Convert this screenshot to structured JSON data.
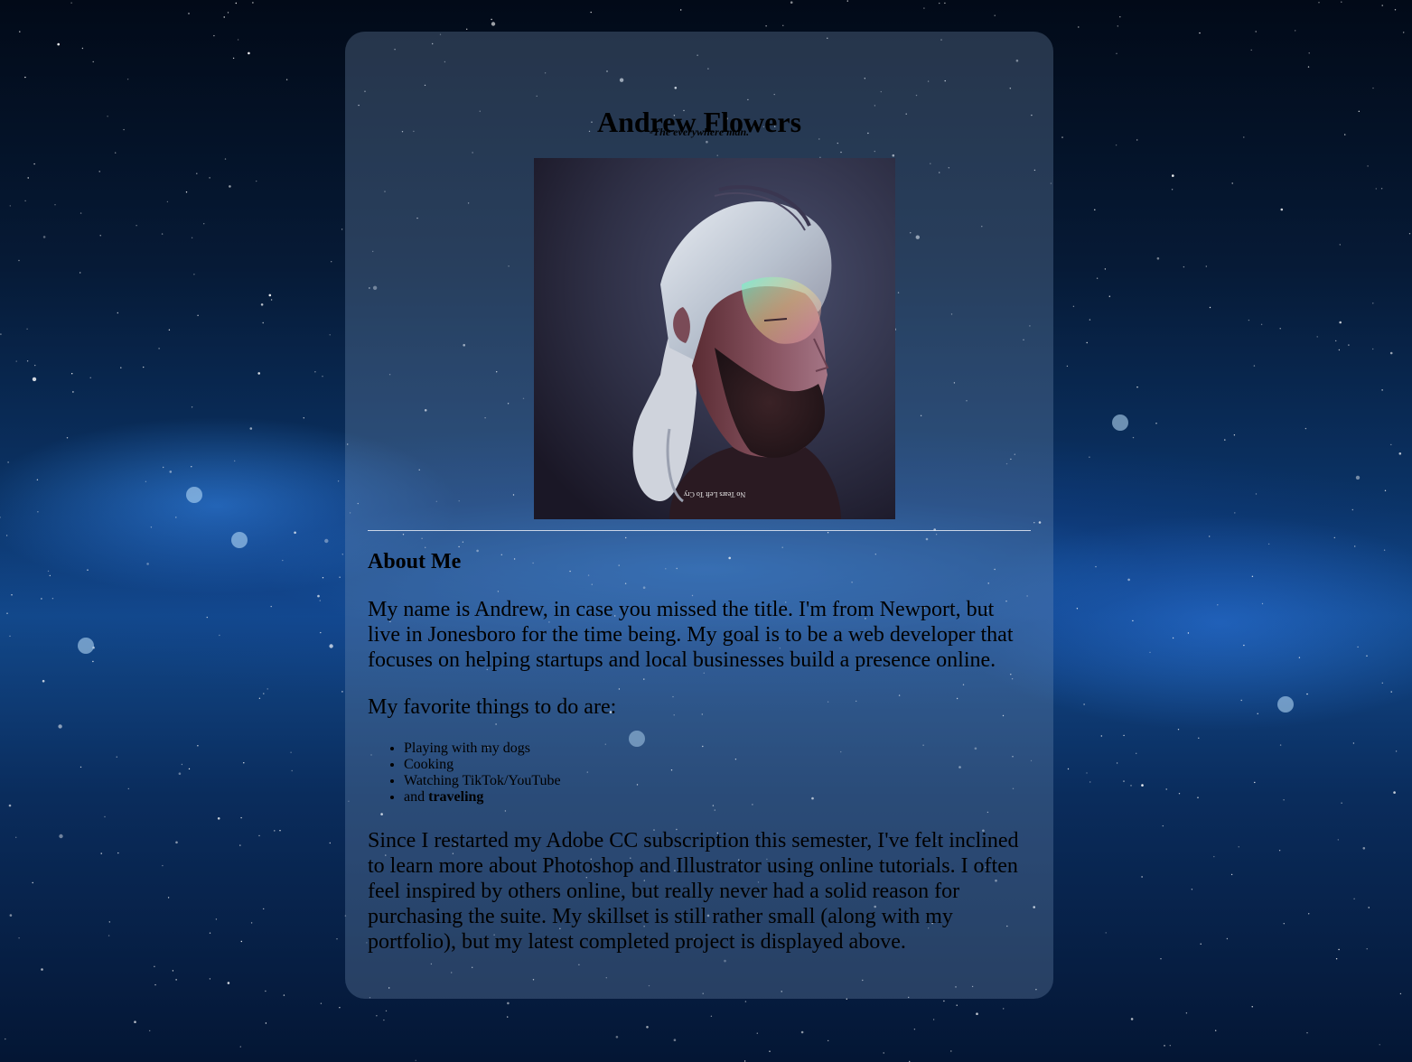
{
  "profile": {
    "name": "Andrew Flowers",
    "tagline": "-The everywhere man.",
    "portrait_caption": "No Tears Left To Cry"
  },
  "about": {
    "heading": "About Me",
    "intro": "My name is Andrew, in case you missed the title. I'm from Newport, but live in Jonesboro for the time being. My goal is to be a web developer that focuses on helping startups and local businesses build a presence online.",
    "favorites_intro": "My favorite things to do are:",
    "favorites": [
      "Playing with my dogs",
      "Cooking",
      "Watching TikTok/YouTube"
    ],
    "favorite_last_prefix": "and",
    "favorite_last_emphasis": "traveling",
    "closing": "Since I restarted my Adobe CC subscription this semester, I've felt inclined to learn more about Photoshop and Illustrator using online tutorials. I often feel inspired by others online, but really never had a solid reason for purchasing the suite. My skillset is still rather small (along with my portfolio), but my latest completed project is displayed above."
  },
  "colors": {
    "card_tint": "#7896b9",
    "page_background": "#0b3468",
    "text": "#000000"
  }
}
